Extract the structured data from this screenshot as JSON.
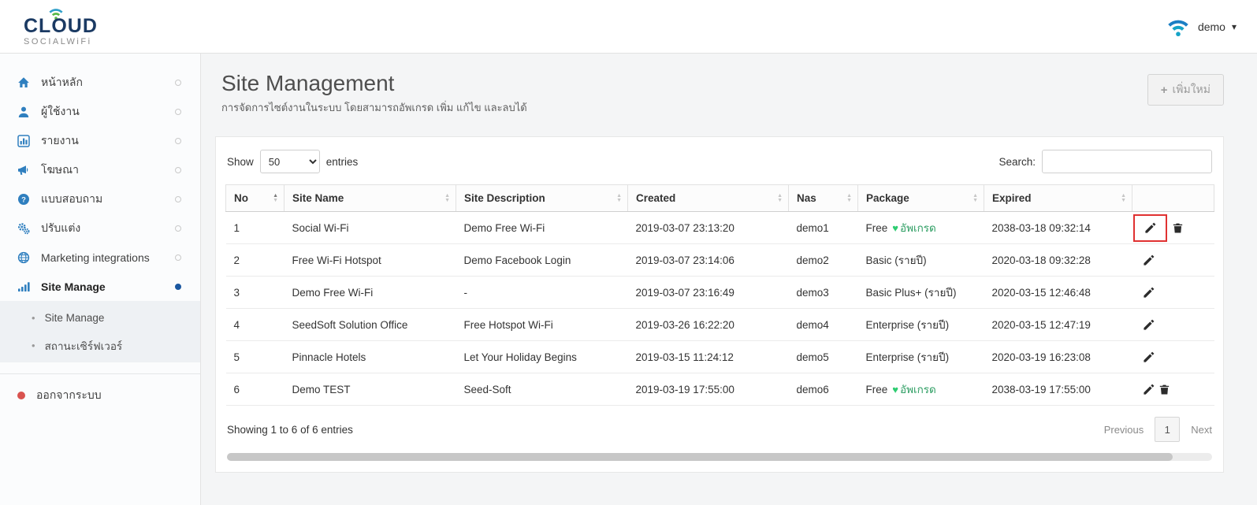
{
  "icons": {
    "plus": "+",
    "caret_down": "▾",
    "sort_asc": "▲",
    "sort_desc": "▼",
    "bullet": "•",
    "heart": "♥"
  },
  "colors": {
    "accent_blue": "#2f7fbf",
    "active_dot": "#1a57a0",
    "upgrade_green": "#2e9e63",
    "heart_green": "#2ecc71",
    "annotation_red": "#e03131",
    "logout_red": "#d9534f",
    "wifi_teal": "#15a3c7"
  },
  "header": {
    "logo_line1": "CLOUD",
    "logo_line2": "SOCIALWiFi",
    "user": "demo"
  },
  "sidebar": {
    "items": [
      {
        "label": "หน้าหลัก",
        "icon": "home-icon"
      },
      {
        "label": "ผู้ใช้งาน",
        "icon": "user-icon"
      },
      {
        "label": "รายงาน",
        "icon": "chart-icon"
      },
      {
        "label": "โฆษณา",
        "icon": "megaphone-icon"
      },
      {
        "label": "แบบสอบถาม",
        "icon": "question-icon"
      },
      {
        "label": "ปรับแต่ง",
        "icon": "gears-icon"
      },
      {
        "label": "Marketing integrations",
        "icon": "globe-icon"
      },
      {
        "label": "Site Manage",
        "icon": "signal-icon",
        "active": true
      }
    ],
    "subitems": [
      {
        "label": "Site Manage"
      },
      {
        "label": "สถานะเซิร์ฟเวอร์"
      }
    ],
    "logout_label": "ออกจากระบบ"
  },
  "page": {
    "title": "Site Management",
    "subtitle": "การจัดการไซต์งานในระบบ โดยสามารถอัพเกรด เพิ่ม แก้ไข และลบได้",
    "add_button_label": "เพิ่มใหม่"
  },
  "table": {
    "show_label": "Show",
    "entries_label": "entries",
    "page_size": "50",
    "search_label": "Search:",
    "search_value": "",
    "columns": [
      "No",
      "Site Name",
      "Site Description",
      "Created",
      "Nas",
      "Package",
      "Expired"
    ],
    "rows": [
      {
        "no": "1",
        "site_name": "Social Wi-Fi",
        "description": "Demo Free Wi-Fi",
        "created": "2019-03-07 23:13:20",
        "nas": "demo1",
        "package": "Free",
        "upgrade": "อัพเกรด",
        "expired": "2038-03-18 09:32:14",
        "can_delete": true,
        "edit_highlighted": true
      },
      {
        "no": "2",
        "site_name": "Free Wi-Fi Hotspot",
        "description": "Demo Facebook Login",
        "created": "2019-03-07 23:14:06",
        "nas": "demo2",
        "package": "Basic (รายปี)",
        "upgrade": "",
        "expired": "2020-03-18 09:32:28",
        "can_delete": false
      },
      {
        "no": "3",
        "site_name": "Demo Free Wi-Fi",
        "description": "-",
        "created": "2019-03-07 23:16:49",
        "nas": "demo3",
        "package": "Basic Plus+ (รายปี)",
        "upgrade": "",
        "expired": "2020-03-15 12:46:48",
        "can_delete": false
      },
      {
        "no": "4",
        "site_name": "SeedSoft Solution Office",
        "description": "Free Hotspot Wi-Fi",
        "created": "2019-03-26 16:22:20",
        "nas": "demo4",
        "package": "Enterprise (รายปี)",
        "upgrade": "",
        "expired": "2020-03-15 12:47:19",
        "can_delete": false
      },
      {
        "no": "5",
        "site_name": "Pinnacle Hotels",
        "description": "Let Your Holiday Begins",
        "created": "2019-03-15 11:24:12",
        "nas": "demo5",
        "package": "Enterprise (รายปี)",
        "upgrade": "",
        "expired": "2020-03-19 16:23:08",
        "can_delete": false
      },
      {
        "no": "6",
        "site_name": "Demo TEST",
        "description": "Seed-Soft",
        "created": "2019-03-19 17:55:00",
        "nas": "demo6",
        "package": "Free",
        "upgrade": "อัพเกรด",
        "expired": "2038-03-19 17:55:00",
        "can_delete": true
      }
    ],
    "footer_text": "Showing 1 to 6 of 6 entries",
    "pagination": {
      "previous": "Previous",
      "page": "1",
      "next": "Next"
    }
  }
}
